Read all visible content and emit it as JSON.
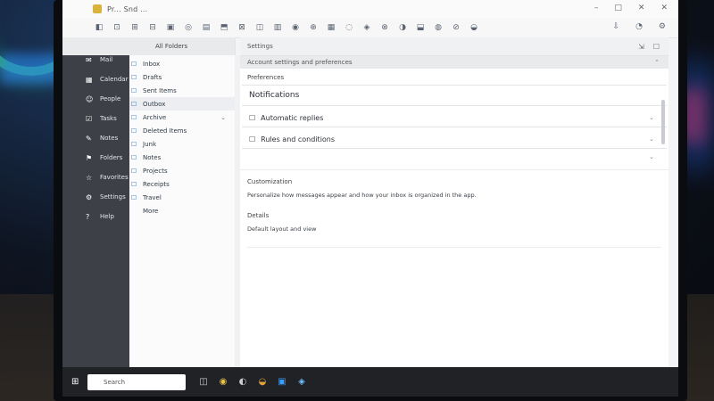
{
  "window": {
    "title": "Pr... Snd ...",
    "controls": [
      "–",
      "□",
      "✕",
      "✕"
    ]
  },
  "toolbar": {
    "icons": [
      "◧",
      "⊡",
      "⊞",
      "⊟",
      "▣",
      "◎",
      "▤",
      "⬒",
      "⊠",
      "◫",
      "▥",
      "◉",
      "⊕",
      "▦",
      "◌",
      "◈",
      "⊗",
      "◑",
      "⬓",
      "◍",
      "⊘",
      "◒"
    ],
    "right_icons": [
      "⇩",
      "◔",
      "⚙"
    ]
  },
  "rail": {
    "items": [
      {
        "icon": "✉",
        "label": "Mail"
      },
      {
        "icon": "▦",
        "label": "Calendar"
      },
      {
        "icon": "☺",
        "label": "People"
      },
      {
        "icon": "☑",
        "label": "Tasks"
      },
      {
        "icon": "✎",
        "label": "Notes"
      },
      {
        "icon": "⚑",
        "label": "Folders"
      },
      {
        "icon": "☆",
        "label": "Favorites"
      },
      {
        "icon": "⚙",
        "label": "Settings"
      },
      {
        "icon": "?",
        "label": "Help"
      }
    ]
  },
  "folders": {
    "header": "All Folders",
    "items": [
      {
        "icon": "☐",
        "label": "Inbox"
      },
      {
        "icon": "☐",
        "label": "Drafts"
      },
      {
        "icon": "☐",
        "label": "Sent Items"
      },
      {
        "icon": "☐",
        "label": "Outbox"
      },
      {
        "icon": "☐",
        "label": "Archive",
        "chevron": "⌄"
      },
      {
        "icon": "☐",
        "label": "Deleted Items"
      },
      {
        "icon": "☐",
        "label": "Junk"
      },
      {
        "icon": "☐",
        "label": "Notes"
      },
      {
        "icon": "☐",
        "label": "Projects"
      },
      {
        "icon": "☐",
        "label": "Receipts"
      },
      {
        "icon": "☐",
        "label": "Travel"
      },
      {
        "icon": "",
        "label": "More"
      }
    ]
  },
  "reader": {
    "header_label": "Settings",
    "header_icons": [
      "⇲",
      "☐"
    ],
    "subheader": "Account settings and preferences",
    "subheader_chev": "⌃",
    "section_label": "Preferences",
    "rows": [
      {
        "icon": "",
        "label": "Notifications",
        "chev": ""
      },
      {
        "icon": "☐",
        "label": "Automatic replies",
        "chev": "⌄"
      },
      {
        "icon": "☐",
        "label": "Rules and conditions",
        "chev": "⌄"
      }
    ],
    "extra_chev": "⌄",
    "detail": {
      "label1": "Customization",
      "value1": "Personalize how messages appear and how your inbox is organized in the app.",
      "label2": "Details",
      "value2": "Default layout and view"
    }
  },
  "taskbar": {
    "start": "⊞",
    "search_placeholder": "Search",
    "apps": [
      "◫",
      "◉",
      "◐",
      "◒",
      "▣",
      "◈"
    ]
  }
}
